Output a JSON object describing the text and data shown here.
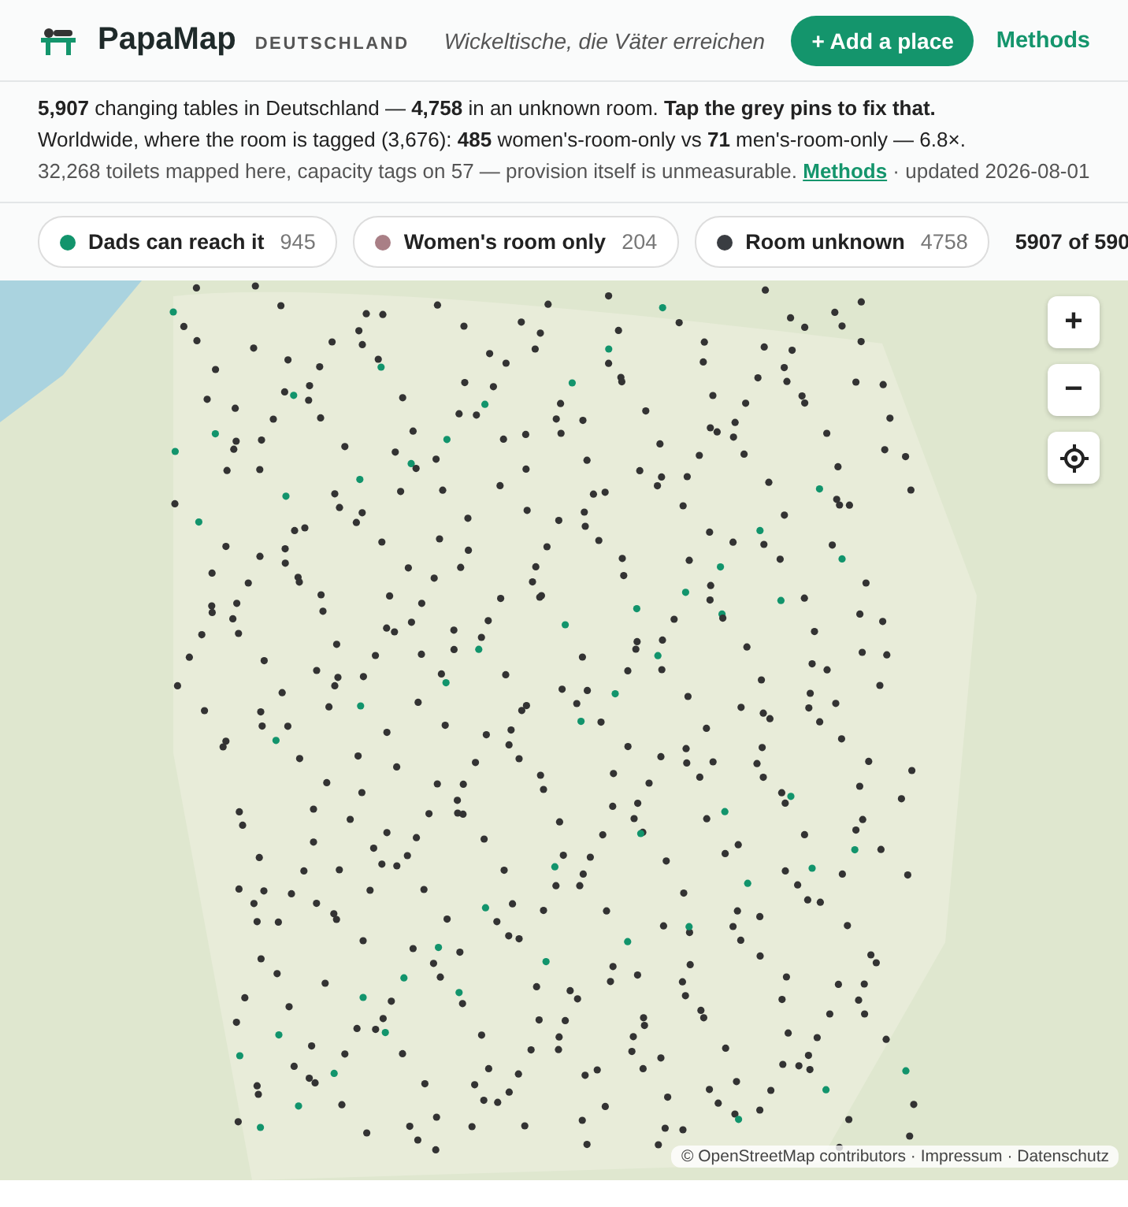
{
  "header": {
    "brand": "PapaMap",
    "region": "DEUTSCHLAND",
    "tagline": "Wickeltische, die Väter erreichen",
    "add_button": "+ Add a place",
    "methods_link": "Methods"
  },
  "summary": {
    "line_1": "**5,907** changing tables in Deutschland — **4,758** in an unknown room. **Tap the grey pins to fix that.**",
    "line_2": "Worldwide, where the room is tagged (3,676): **485** women's-room-only vs **71** men's-room-only — 6.8×.",
    "line_3_before": "32,268 toilets mapped here, capacity tags on 57 — provision itself is unmeasurable.",
    "line_3_link": "Methods",
    "line_3_after": "· updated 2026-08-01"
  },
  "legend": [
    {
      "label": "Dads can reach it",
      "count": "945",
      "color": "#12946c"
    },
    {
      "label": "Women's room only",
      "count": "204",
      "color": "#a97f86"
    },
    {
      "label": "Room unknown",
      "count": "4758",
      "color": "#3a3d42"
    }
  ],
  "shown_count": "5907 of 590",
  "map_controls": [
    {
      "kind": "zoom-in",
      "label": "+"
    },
    {
      "kind": "zoom-out",
      "label": "−"
    },
    {
      "kind": "locate"
    }
  ],
  "attribution": {
    "text": "© OpenStreetMap contributors ·",
    "links": [
      "Impressum",
      "Datenschutz"
    ],
    "separator": "·"
  }
}
